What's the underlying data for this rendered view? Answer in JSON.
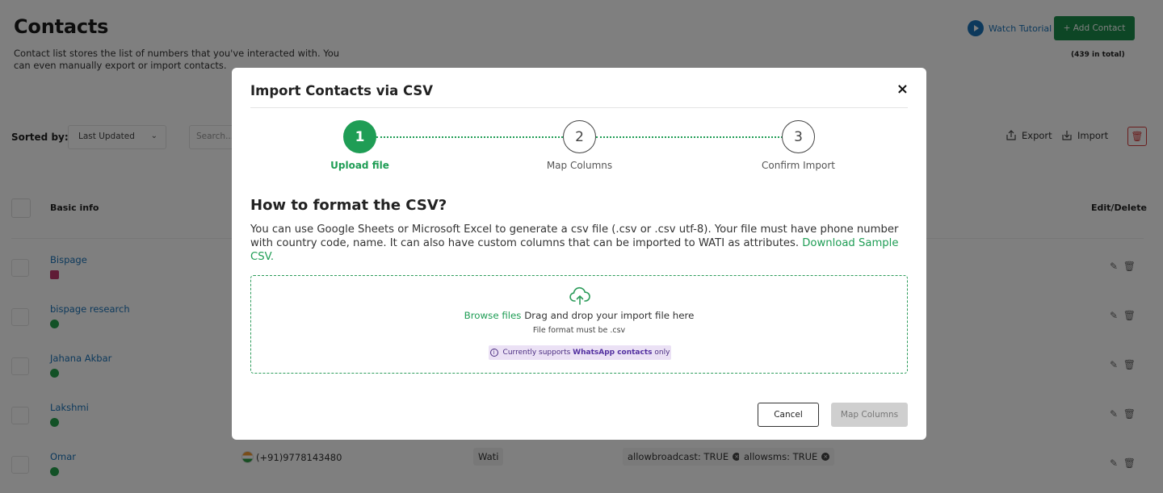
{
  "page": {
    "title": "Contacts",
    "description": "Contact list stores the list of numbers that you've interacted with. You can even manually export or import contacts.",
    "watch_tutorial": "Watch Tutorial",
    "add_contact": "+ Add Contact",
    "total": "(439 in total)"
  },
  "toolbar": {
    "sorted_by_label": "Sorted by:",
    "sort_value": "Last Updated",
    "search_placeholder": "Search...",
    "export_label": "Export",
    "import_label": "Import"
  },
  "table": {
    "col_basic_info": "Basic info",
    "col_edit_delete": "Edit/Delete",
    "rows": [
      {
        "name": "Bispage",
        "channel": "instagram"
      },
      {
        "name": "bispage research",
        "channel": "whatsapp"
      },
      {
        "name": "Jahana Akbar",
        "channel": "whatsapp"
      },
      {
        "name": "Lakshmi",
        "channel": "whatsapp"
      },
      {
        "name": "Omar",
        "channel": "whatsapp",
        "phone": "(+91)9778143480",
        "source": "Wati",
        "attr1": "allowbroadcast: TRUE",
        "attr2": "allowsms: TRUE"
      }
    ]
  },
  "modal": {
    "title": "Import Contacts via CSV",
    "close": "×",
    "steps": [
      {
        "number": "1",
        "label": "Upload file",
        "active": true
      },
      {
        "number": "2",
        "label": "Map Columns",
        "active": false
      },
      {
        "number": "3",
        "label": "Confirm Import",
        "active": false
      }
    ],
    "how_title": "How to format the CSV?",
    "how_text": "You can use Google Sheets or Microsoft Excel to generate a csv file (.csv or .csv utf-8). Your file must have phone number with country code, name. It can also have custom columns that can be imported to WATI as attributes.",
    "download_link": "Download Sample CSV.",
    "drop": {
      "browse": "Browse files",
      "text": "Drag and drop your import file here",
      "format": "File format must be .csv",
      "support_prefix": "Currently supports",
      "support_bold": "WhatsApp contacts",
      "support_suffix": "only"
    },
    "cancel": "Cancel",
    "next": "Map Columns"
  },
  "colors": {
    "accent_green": "#1f9d55",
    "brand_blue": "#1a73b8",
    "pill_purple": "#ebe1f5"
  }
}
